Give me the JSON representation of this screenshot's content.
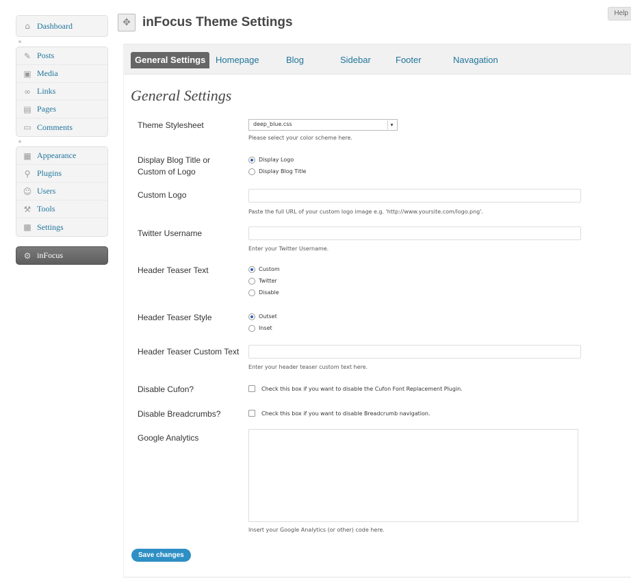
{
  "help_label": "Help",
  "sidebar": {
    "top": [
      {
        "label": "Dashboard",
        "icon": "home-icon"
      }
    ],
    "content": [
      {
        "label": "Posts",
        "icon": "pin-icon"
      },
      {
        "label": "Media",
        "icon": "media-icon"
      },
      {
        "label": "Links",
        "icon": "link-icon"
      },
      {
        "label": "Pages",
        "icon": "page-icon"
      },
      {
        "label": "Comments",
        "icon": "comment-icon"
      }
    ],
    "admin": [
      {
        "label": "Appearance",
        "icon": "appearance-icon"
      },
      {
        "label": "Plugins",
        "icon": "plugin-icon"
      },
      {
        "label": "Users",
        "icon": "users-icon"
      },
      {
        "label": "Tools",
        "icon": "tools-icon"
      },
      {
        "label": "Settings",
        "icon": "settings-icon"
      }
    ],
    "active": {
      "label": "inFocus",
      "icon": "gear-icon"
    }
  },
  "page": {
    "title": "inFocus Theme Settings"
  },
  "tabs": [
    {
      "label": "General Settings",
      "active": true
    },
    {
      "label": "Homepage"
    },
    {
      "label": "Blog"
    },
    {
      "label": "Sidebar"
    },
    {
      "label": "Footer"
    },
    {
      "label": "Navagation"
    }
  ],
  "section_title": "General Settings",
  "fields": {
    "stylesheet": {
      "label": "Theme Stylesheet",
      "value": "deep_blue.css",
      "hint": "Please select your color scheme here."
    },
    "blog_title": {
      "label": "Display Blog Title or Custom of Logo",
      "options": [
        "Display Logo",
        "Display Blog Title"
      ],
      "selected": "Display Logo"
    },
    "custom_logo": {
      "label": "Custom Logo",
      "value": "",
      "hint": "Paste the full URL of your custom logo image e.g. 'http://www.yoursite.com/logo.png'."
    },
    "twitter": {
      "label": "Twitter Username",
      "value": "",
      "hint": "Enter your Twitter Username."
    },
    "teaser_text": {
      "label": "Header Teaser Text",
      "options": [
        "Custom",
        "Twitter",
        "Disable"
      ],
      "selected": "Custom"
    },
    "teaser_style": {
      "label": "Header Teaser Style",
      "options": [
        "Outset",
        "Inset"
      ],
      "selected": "Outset"
    },
    "teaser_custom": {
      "label": "Header Teaser Custom Text",
      "value": "",
      "hint": "Enter your header teaser custom text here."
    },
    "cufon": {
      "label": "Disable Cufon?",
      "text": "Check this box if you want to disable the Cufon Font Replacement Plugin.",
      "checked": false
    },
    "breadcrumbs": {
      "label": "Disable Breadcrumbs?",
      "text": "Check this box if you want to disable Breadcrumb navigation.",
      "checked": false
    },
    "analytics": {
      "label": "Google Analytics",
      "value": "",
      "hint": "Insert your Google Analytics (or other) code here."
    }
  },
  "save_label": "Save changes",
  "colors": {
    "link": "#21759b",
    "active_tab": "#666666",
    "save_button": "#2e8fc4"
  }
}
